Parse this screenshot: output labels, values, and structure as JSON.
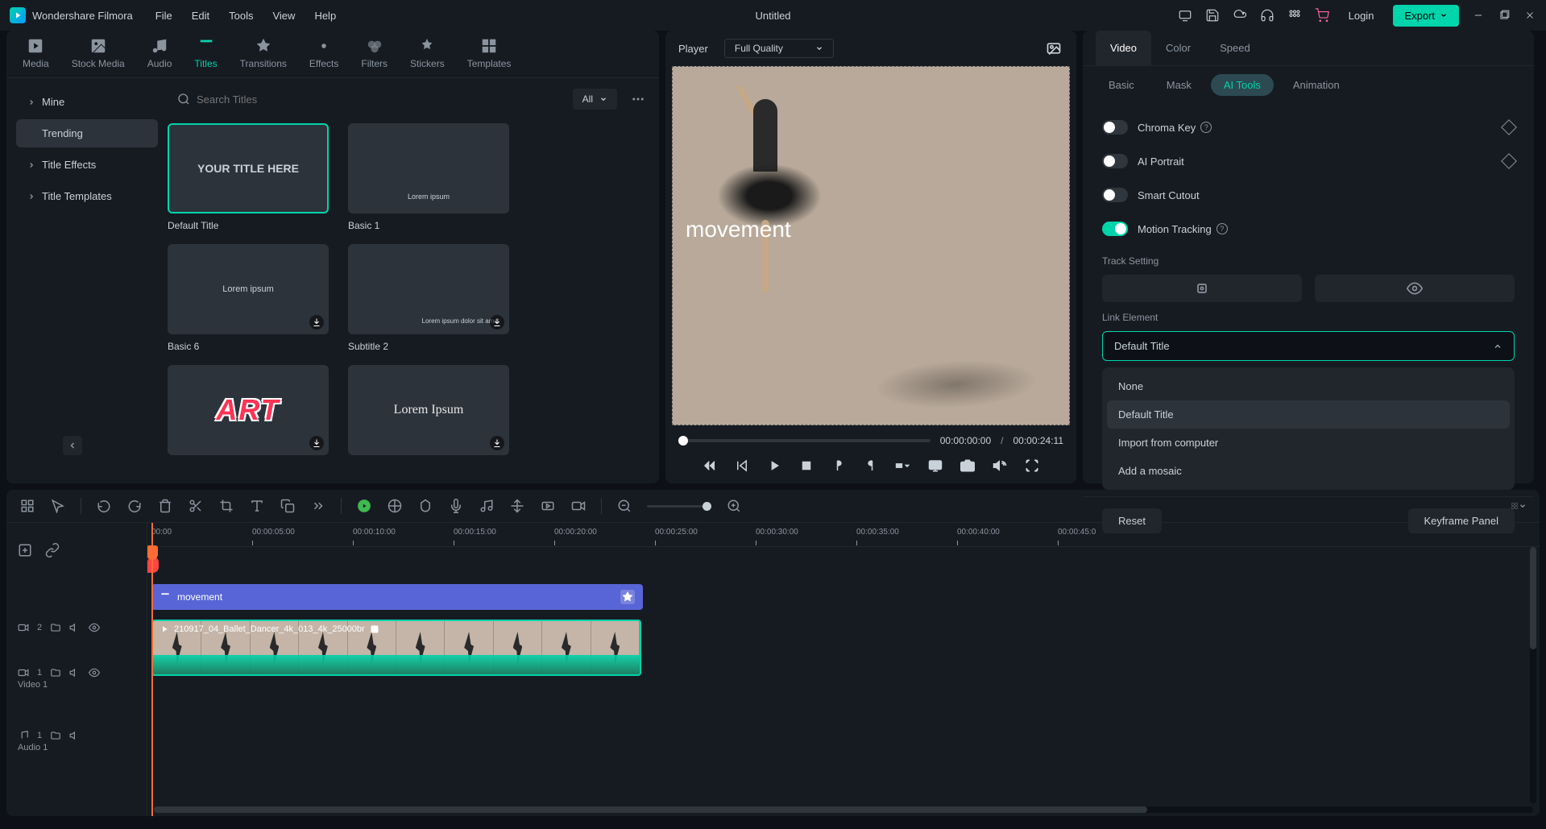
{
  "app_name": "Wondershare Filmora",
  "document_title": "Untitled",
  "menu": [
    "File",
    "Edit",
    "Tools",
    "View",
    "Help"
  ],
  "titlebar": {
    "login": "Login",
    "export": "Export"
  },
  "top_tabs": [
    {
      "label": "Media",
      "icon": "media"
    },
    {
      "label": "Stock Media",
      "icon": "stock"
    },
    {
      "label": "Audio",
      "icon": "audio"
    },
    {
      "label": "Titles",
      "icon": "titles",
      "active": true
    },
    {
      "label": "Transitions",
      "icon": "transitions"
    },
    {
      "label": "Effects",
      "icon": "effects"
    },
    {
      "label": "Filters",
      "icon": "filters"
    },
    {
      "label": "Stickers",
      "icon": "stickers"
    },
    {
      "label": "Templates",
      "icon": "templates"
    }
  ],
  "sidebar": {
    "items": [
      {
        "label": "Mine",
        "expandable": true
      },
      {
        "label": "Trending",
        "active": true
      },
      {
        "label": "Title Effects",
        "expandable": true
      },
      {
        "label": "Title Templates",
        "expandable": true
      }
    ]
  },
  "search": {
    "placeholder": "Search Titles"
  },
  "filter": {
    "label": "All"
  },
  "tiles": [
    {
      "label": "Default Title",
      "preview": "YOUR TITLE HERE",
      "selected": true
    },
    {
      "label": "Basic 1",
      "preview": "Lorem ipsum"
    },
    {
      "label": "Basic 6",
      "preview": "Lorem ipsum",
      "downloadable": true
    },
    {
      "label": "Subtitle 2",
      "preview": "Lorem ipsum dolor sit amet",
      "downloadable": true
    },
    {
      "label": "",
      "preview": "ART",
      "style": "art",
      "downloadable": true
    },
    {
      "label": "",
      "preview": "Lorem Ipsum",
      "style": "serif",
      "downloadable": true
    }
  ],
  "player": {
    "label": "Player",
    "quality": "Full Quality",
    "title_text": "movement",
    "current_time": "00:00:00:00",
    "duration": "00:00:24:11"
  },
  "right_panel": {
    "tabs": [
      "Video",
      "Color",
      "Speed"
    ],
    "active_tab": "Video",
    "subtabs": [
      "Basic",
      "Mask",
      "AI Tools",
      "Animation"
    ],
    "active_subtab": "AI Tools",
    "toggles": [
      {
        "label": "Chroma Key",
        "on": false,
        "help": true,
        "keyframe": true
      },
      {
        "label": "AI Portrait",
        "on": false,
        "keyframe": true
      },
      {
        "label": "Smart Cutout",
        "on": false
      },
      {
        "label": "Motion Tracking",
        "on": true,
        "help": true
      }
    ],
    "track_setting_label": "Track Setting",
    "link_element_label": "Link Element",
    "link_element_value": "Default Title",
    "link_options": [
      "None",
      "Default Title",
      "Import from computer",
      "Add a mosaic"
    ],
    "reset": "Reset",
    "keyframe_panel": "Keyframe Panel"
  },
  "timeline": {
    "ruler": [
      "00:00",
      "00:00:05:00",
      "00:00:10:00",
      "00:00:15:00",
      "00:00:20:00",
      "00:00:25:00",
      "00:00:30:00",
      "00:00:35:00",
      "00:00:40:00",
      "00:00:45:0"
    ],
    "title_clip": {
      "label": "movement"
    },
    "video_clip": {
      "label": "210917_04_Ballet_Dancer_4k_013_4k_25000br"
    },
    "tracks": [
      {
        "type": "title",
        "num": "2"
      },
      {
        "type": "video",
        "num": "1",
        "name": "Video 1"
      },
      {
        "type": "audio",
        "num": "1",
        "name": "Audio 1"
      }
    ]
  }
}
